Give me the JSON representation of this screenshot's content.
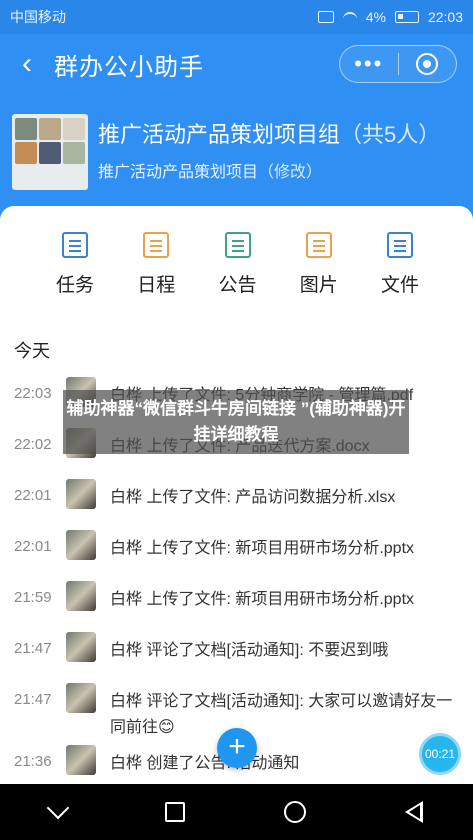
{
  "statusbar": {
    "carrier": "中国移动",
    "battery": "4%",
    "time": "22:03"
  },
  "navbar": {
    "back_icon": "chevron-left-icon",
    "title": "群办公小助手",
    "more_label": "•••"
  },
  "group": {
    "name": "推广活动产品策划项目组",
    "member_count": "（共5人）",
    "subtitle": "推广活动产品策划项目",
    "edit_label": "（修改）"
  },
  "tools": [
    {
      "label": "任务",
      "icon": "task-list-icon",
      "color": "#3a82d6"
    },
    {
      "label": "日程",
      "icon": "calendar-icon",
      "color": "#e9a14c"
    },
    {
      "label": "公告",
      "icon": "announcement-icon",
      "color": "#3fa37d"
    },
    {
      "label": "图片",
      "icon": "image-icon",
      "color": "#e9a14c"
    },
    {
      "label": "文件",
      "icon": "file-icon",
      "color": "#3a82d6"
    }
  ],
  "feed": {
    "section_title": "今天",
    "items": [
      {
        "time": "22:03",
        "text": "白桦 上传了文件: 5分钟商学院 - 管理篇.pdf"
      },
      {
        "time": "22:02",
        "text": "白桦 上传了文件: 产品迭代方案.docx"
      },
      {
        "time": "22:01",
        "text": "白桦 上传了文件: 产品访问数据分析.xlsx"
      },
      {
        "time": "22:01",
        "text": "白桦 上传了文件: 新项目用研市场分析.pptx"
      },
      {
        "time": "21:59",
        "text": "白桦 上传了文件: 新项目用研市场分析.pptx"
      },
      {
        "time": "21:47",
        "text": "白桦 评论了文档[活动通知]: 不要迟到哦"
      },
      {
        "time": "21:47",
        "text": "白桦 评论了文档[活动通知]: 大家可以邀请好友一同前往😊"
      },
      {
        "time": "21:36",
        "text": "白桦 创建了公告: 活动通知"
      }
    ]
  },
  "overlay": {
    "text": "辅助神器“微信群斗牛房间链接 ”(辅助神器)开挂详细教程"
  },
  "fab": {
    "label": "+"
  },
  "timer": {
    "label": "00:21"
  }
}
